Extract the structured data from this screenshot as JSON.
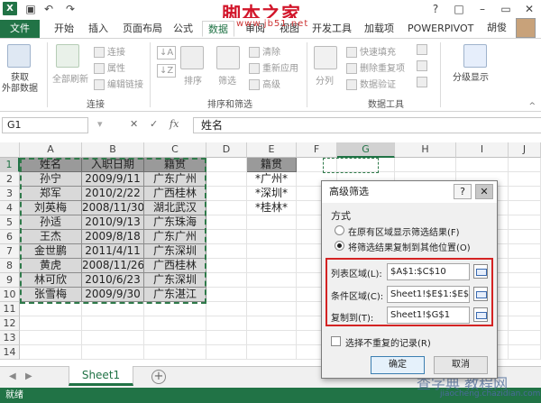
{
  "quick_access": {
    "undo": "↶",
    "redo": "↷",
    "save": "▣"
  },
  "watermark": {
    "title": "脚本之家",
    "subtitle": "www.jb51.net"
  },
  "window_controls": {
    "help": "?",
    "restore": "□",
    "minimize": "–",
    "maximize": "▭",
    "close": "✕"
  },
  "tabs": [
    "文件",
    "开始",
    "插入",
    "页面布局",
    "公式",
    "数据",
    "审阅",
    "视图",
    "开发工具",
    "加载项",
    "POWERPIVOT"
  ],
  "active_tab": "数据",
  "user": {
    "name": "胡俊"
  },
  "ribbon": {
    "get_external": "获取",
    "get_external_2": "外部数据",
    "refresh_all": "全部刷新",
    "connections": "连接",
    "properties": "属性",
    "edit_links": "编辑链接",
    "group_connections": "连接",
    "sort_asc": "↓A",
    "sort_desc": "↓Z",
    "sort": "排序",
    "filter": "筛选",
    "clear": "清除",
    "reapply": "重新应用",
    "advanced": "高级",
    "group_sort_filter": "排序和筛选",
    "split": "分列",
    "flash_fill": "快速填充",
    "remove_duplicates": "删除重复项",
    "validation": "数据验证",
    "group_data_tools": "数据工具",
    "outline": "分级显示"
  },
  "formula_bar": {
    "name_box": "G1",
    "cancel": "✕",
    "enter": "✓",
    "fx": "fx",
    "value": "姓名"
  },
  "columns": [
    "A",
    "B",
    "C",
    "D",
    "E",
    "F",
    "G",
    "H",
    "I",
    "J"
  ],
  "rows": [
    "1",
    "2",
    "3",
    "4",
    "5",
    "6",
    "7",
    "8",
    "9",
    "10",
    "11",
    "12",
    "13",
    "14"
  ],
  "table": {
    "headers": [
      "姓名",
      "入职日期",
      "籍贯"
    ],
    "rows": [
      [
        "孙宁",
        "2009/9/11",
        "广东广州"
      ],
      [
        "郑军",
        "2010/2/22",
        "广西桂林"
      ],
      [
        "刘英梅",
        "2008/11/30",
        "湖北武汉"
      ],
      [
        "孙适",
        "2010/9/13",
        "广东珠海"
      ],
      [
        "王杰",
        "2009/8/18",
        "广东广州"
      ],
      [
        "金世鹏",
        "2011/4/11",
        "广东深圳"
      ],
      [
        "黄虎",
        "2008/11/26",
        "广西桂林"
      ],
      [
        "林可欣",
        "2010/6/23",
        "广东深圳"
      ],
      [
        "张雪梅",
        "2009/9/30",
        "广东湛江"
      ]
    ]
  },
  "criteria": {
    "header": "籍贯",
    "values": [
      "*广州*",
      "*深圳*",
      "*桂林*"
    ]
  },
  "sheet_tabs": {
    "nav_prev": "◀",
    "nav_next": "▶",
    "sheet": "Sheet1",
    "add": "+"
  },
  "status": "就绪",
  "dialog": {
    "title": "高级筛选",
    "help": "?",
    "close": "✕",
    "mode_label": "方式",
    "option_in_place": "在原有区域显示筛选结果(F)",
    "option_copy": "将筛选结果复制到其他位置(O)",
    "list_range_label": "列表区域(L):",
    "list_range_value": "$A$1:$C$10",
    "criteria_range_label": "条件区域(C):",
    "criteria_range_value": "Sheet1!$E$1:$E$4",
    "copy_to_label": "复制到(T):",
    "copy_to_value": "Sheet1!$G$1",
    "unique_label": "选择不重复的记录(R)",
    "ok": "确定",
    "cancel": "取消"
  },
  "corner_watermark": {
    "main": "查字典 教程网",
    "sub": "jiaocheng.chazidian.com"
  },
  "colors": {
    "excel_green": "#217346",
    "highlight_red": "#d42323",
    "watermark_red": "#d2152a"
  }
}
